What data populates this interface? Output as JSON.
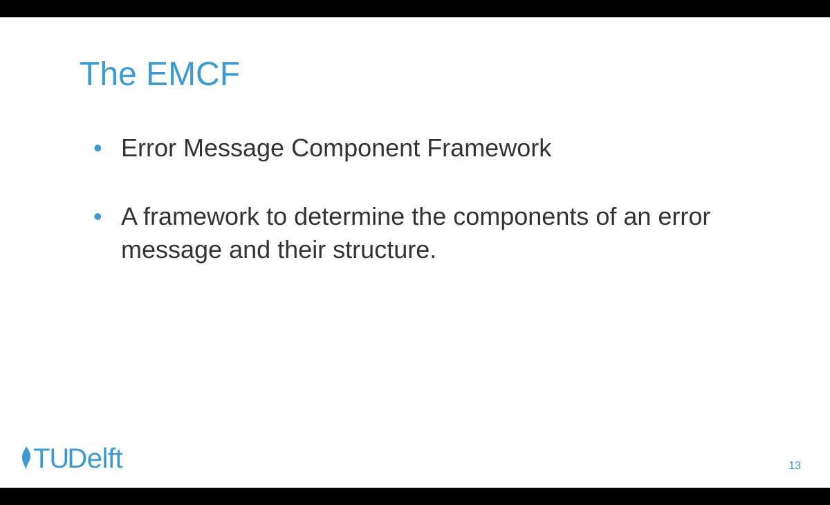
{
  "slide": {
    "title": "The EMCF",
    "bullets": [
      "Error Message Component Framework",
      "A framework to determine the components of an error message and their structure."
    ],
    "page_number": "13",
    "logo": {
      "prefix": "TU",
      "suffix": "Delft"
    },
    "colors": {
      "accent": "#3d9ad1"
    }
  }
}
